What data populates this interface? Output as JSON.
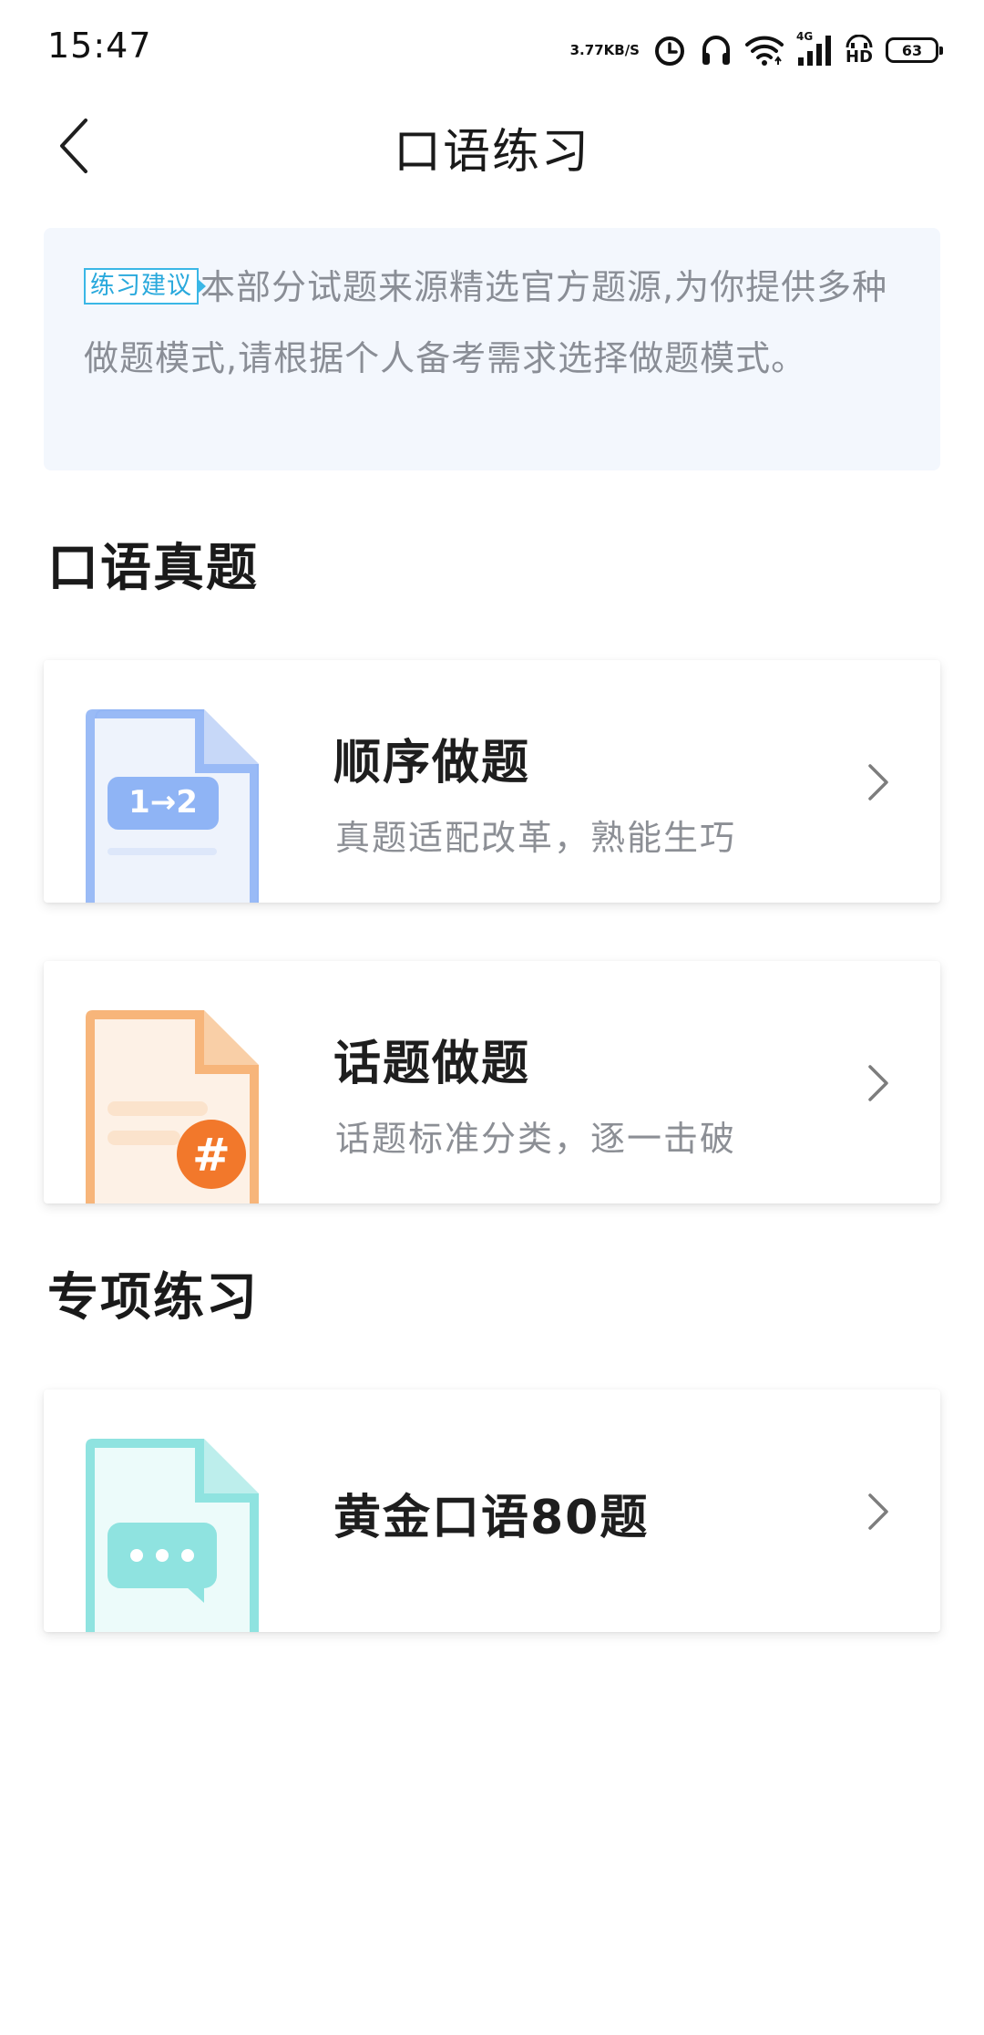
{
  "status_bar": {
    "time": "15:47",
    "net_speed_value": "3.77",
    "net_speed_unit": "KB/S",
    "network_type": "4G",
    "hd_label": "HD",
    "battery": "63"
  },
  "header": {
    "title": "口语练习"
  },
  "tip": {
    "tag": "练习建议",
    "text": "本部分试题来源精选官方题源,为你提供多种做题模式,请根据个人备考需求选择做题模式。"
  },
  "sections": {
    "real_exam": {
      "title": "口语真题",
      "cards": {
        "sequential": {
          "title": "顺序做题",
          "subtitle": "真题适配改革，熟能生巧",
          "icon_badge": "1→2"
        },
        "topic": {
          "title": "话题做题",
          "subtitle": "话题标准分类，逐一击破",
          "icon_badge": "#"
        }
      }
    },
    "special": {
      "title": "专项练习",
      "cards": {
        "gold80": {
          "title": "黄金口语80题"
        }
      }
    }
  },
  "colors": {
    "blue_icon": "#8fb4f5",
    "orange_icon": "#f7b57a",
    "teal_icon": "#8fe3e0",
    "tip_bg": "#f3f7fd",
    "tag_border": "#3ab7e6"
  }
}
